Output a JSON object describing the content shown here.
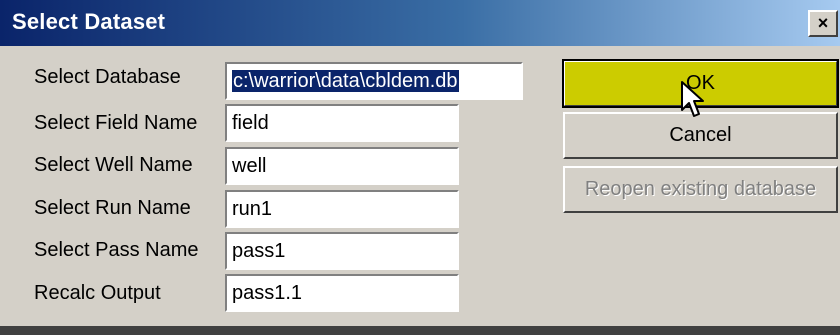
{
  "window": {
    "title": "Select Dataset",
    "close_glyph": "×"
  },
  "fields": [
    {
      "label": "Select Database",
      "value": "c:\\warrior\\data\\cbldem.db"
    },
    {
      "label": "Select Field Name",
      "value": "field"
    },
    {
      "label": "Select Well Name",
      "value": "well"
    },
    {
      "label": "Select Run Name",
      "value": "run1"
    },
    {
      "label": "Select Pass Name",
      "value": "pass1"
    },
    {
      "label": "Recalc Output",
      "value": "pass1.1"
    }
  ],
  "buttons": {
    "ok": "OK",
    "cancel": "Cancel",
    "reopen": "Reopen existing database"
  },
  "colors": {
    "title_start": "#0a246a",
    "title_end": "#a6caf0",
    "ok_highlight": "#cccc00",
    "face": "#d4d0c8"
  },
  "icons": {
    "cursor": "mouse-pointer-icon"
  }
}
